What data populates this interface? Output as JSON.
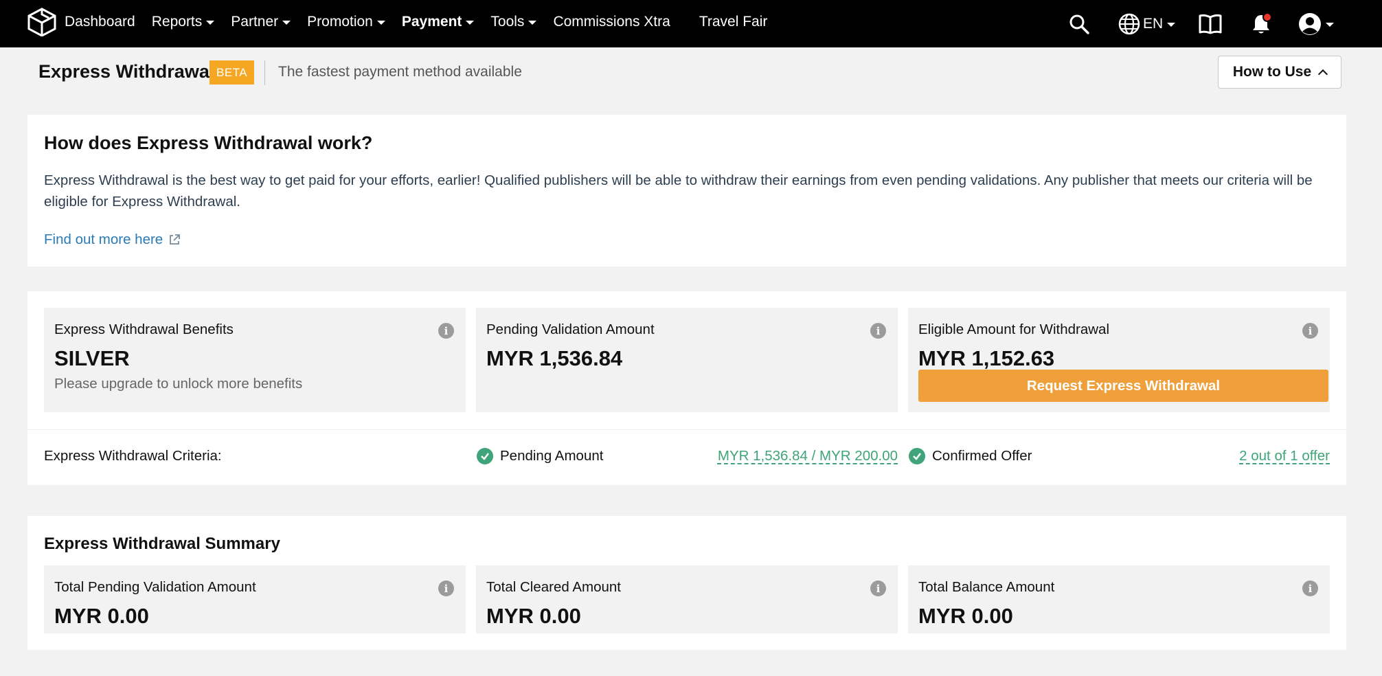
{
  "nav": {
    "items": [
      {
        "label": "Dashboard",
        "caret": false,
        "active": false
      },
      {
        "label": "Reports",
        "caret": true,
        "active": false
      },
      {
        "label": "Partner",
        "caret": true,
        "active": false
      },
      {
        "label": "Promotion",
        "caret": true,
        "active": false
      },
      {
        "label": "Payment",
        "caret": true,
        "active": true
      },
      {
        "label": "Tools",
        "caret": true,
        "active": false
      },
      {
        "label": "Commissions Xtra",
        "caret": false,
        "active": false
      },
      {
        "label": "Travel Fair",
        "caret": false,
        "active": false
      }
    ],
    "language": "EN",
    "icons": [
      "logo-icon",
      "search-icon",
      "globe-icon",
      "book-icon",
      "bell-icon",
      "user-avatar-icon"
    ],
    "notification_dot_color": "#e8352e"
  },
  "header": {
    "title": "Express Withdrawal",
    "badge": "BETA",
    "subtitle": "The fastest payment method available",
    "how_to_use": "How to Use"
  },
  "info": {
    "title": "How does Express Withdrawal work?",
    "text": "Express Withdrawal is the best way to get paid for your efforts, earlier! Qualified publishers will be able to withdraw their earnings from even pending validations. Any publisher that meets our criteria will be eligible for Express Withdrawal.",
    "link": "Find out more here"
  },
  "stats": {
    "benefits": {
      "label": "Express Withdrawal Benefits",
      "value": "SILVER",
      "note": "Please upgrade to unlock more benefits"
    },
    "pending": {
      "label": "Pending Validation Amount",
      "value": "MYR 1,536.84"
    },
    "eligible": {
      "label": "Eligible Amount for Withdrawal",
      "value": "MYR 1,152.63",
      "button": "Request Express Withdrawal"
    }
  },
  "criteria": {
    "label": "Express Withdrawal Criteria:",
    "items": [
      {
        "name": "Pending Amount",
        "value": "MYR 1,536.84 / MYR 200.00"
      },
      {
        "name": "Confirmed Offer",
        "value": "2 out of 1 offer"
      }
    ]
  },
  "summary": {
    "title": "Express Withdrawal Summary",
    "boxes": [
      {
        "label": "Total Pending Validation Amount",
        "value": "MYR 0.00"
      },
      {
        "label": "Total Cleared Amount",
        "value": "MYR 0.00"
      },
      {
        "label": "Total Balance Amount",
        "value": "MYR 0.00"
      }
    ]
  },
  "colors": {
    "nav_bg": "#000000",
    "beta_badge": "#f5a623",
    "request_button": "#f0a03a",
    "success_green": "#3fa47a",
    "link_blue": "#2a7ab8"
  }
}
